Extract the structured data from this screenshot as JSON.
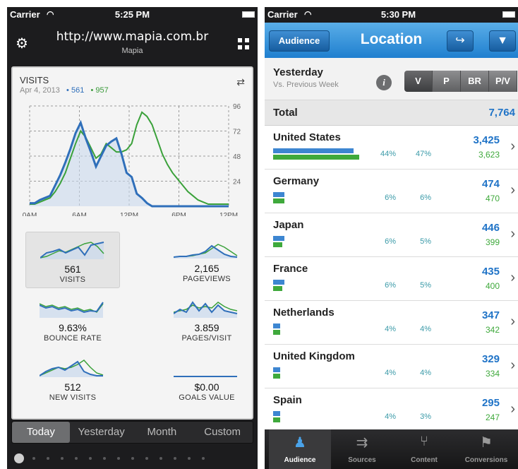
{
  "left": {
    "status_bar": {
      "carrier": "Carrier",
      "time": "5:25 PM"
    },
    "nav": {
      "url": "http://www.mapia.com.br",
      "subtitle": "Mapia"
    },
    "card": {
      "title": "VISITS",
      "date": "Apr 4, 2013",
      "legend_a": "• 561",
      "legend_b": "• 957"
    },
    "chart_data": {
      "type": "line",
      "title": "VISITS",
      "x_ticks": [
        "0AM",
        "6AM",
        "12PM",
        "6PM",
        "12PM"
      ],
      "y_ticks": [
        "96",
        "72",
        "48",
        "24"
      ],
      "ylim": [
        0,
        96
      ],
      "series": [
        {
          "name": "561",
          "color": "#2f6fba",
          "values": [
            3,
            3,
            6,
            8,
            10,
            20,
            30,
            42,
            55,
            70,
            80,
            65,
            52,
            38,
            48,
            58,
            62,
            65,
            50,
            32,
            28,
            12,
            8,
            3,
            0,
            0,
            0,
            0,
            0,
            0,
            0,
            0,
            0,
            0,
            0,
            0,
            0,
            0,
            0,
            0
          ]
        },
        {
          "name": "957",
          "color": "#3aa13a",
          "values": [
            2,
            2,
            4,
            6,
            8,
            14,
            22,
            32,
            46,
            60,
            72,
            66,
            56,
            46,
            50,
            60,
            56,
            52,
            52,
            54,
            60,
            78,
            90,
            86,
            78,
            64,
            50,
            40,
            32,
            26,
            20,
            14,
            10,
            6,
            4,
            2,
            2,
            2,
            2,
            2
          ]
        }
      ],
      "grid": true
    },
    "metrics": [
      {
        "value": "561",
        "label": "VISITS",
        "selected": true
      },
      {
        "value": "2,165",
        "label": "PAGEVIEWS",
        "selected": false
      },
      {
        "value": "9.63%",
        "label": "BOUNCE RATE",
        "selected": false
      },
      {
        "value": "3.859",
        "label": "PAGES/VISIT",
        "selected": false
      },
      {
        "value": "512",
        "label": "NEW VISITS",
        "selected": false
      },
      {
        "value": "$0.00",
        "label": "GOALS VALUE",
        "selected": false
      }
    ],
    "segments": [
      "Today",
      "Yesterday",
      "Month",
      "Custom"
    ],
    "active_segment": 0
  },
  "right": {
    "status_bar": {
      "carrier": "Carrier",
      "time": "5:30 PM"
    },
    "nav": {
      "back_label": "Audience",
      "title": "Location"
    },
    "comparison": {
      "title": "Yesterday",
      "subtitle": "Vs. Previous Week",
      "metrics": [
        "V",
        "P",
        "BR",
        "P/V"
      ],
      "active_metric": 0
    },
    "total": {
      "label": "Total",
      "value": "7,764"
    },
    "locations": [
      {
        "name": "United States",
        "pct_a": "44%",
        "pct_b": "47%",
        "value_a": "3,425",
        "value_b": "3,623",
        "share_a": 0.44,
        "share_b": 0.47
      },
      {
        "name": "Germany",
        "pct_a": "6%",
        "pct_b": "6%",
        "value_a": "474",
        "value_b": "470",
        "share_a": 0.06,
        "share_b": 0.06
      },
      {
        "name": "Japan",
        "pct_a": "6%",
        "pct_b": "5%",
        "value_a": "446",
        "value_b": "399",
        "share_a": 0.06,
        "share_b": 0.05
      },
      {
        "name": "France",
        "pct_a": "6%",
        "pct_b": "5%",
        "value_a": "435",
        "value_b": "400",
        "share_a": 0.06,
        "share_b": 0.05
      },
      {
        "name": "Netherlands",
        "pct_a": "4%",
        "pct_b": "4%",
        "value_a": "347",
        "value_b": "342",
        "share_a": 0.04,
        "share_b": 0.04
      },
      {
        "name": "United Kingdom",
        "pct_a": "4%",
        "pct_b": "4%",
        "value_a": "329",
        "value_b": "334",
        "share_a": 0.04,
        "share_b": 0.04
      },
      {
        "name": "Spain",
        "pct_a": "4%",
        "pct_b": "3%",
        "value_a": "295",
        "value_b": "247",
        "share_a": 0.04,
        "share_b": 0.03
      }
    ],
    "tabs": [
      {
        "label": "Audience",
        "icon": "person-icon",
        "active": true
      },
      {
        "label": "Sources",
        "icon": "sources-arrows-icon",
        "active": false
      },
      {
        "label": "Content",
        "icon": "content-fork-icon",
        "active": false
      },
      {
        "label": "Conversions",
        "icon": "flag-icon",
        "active": false
      }
    ]
  },
  "colors": {
    "blue": "#2f6fba",
    "green": "#3aa13a",
    "nav_blue": "#1f7fcf",
    "value_blue": "#1f73c7"
  }
}
